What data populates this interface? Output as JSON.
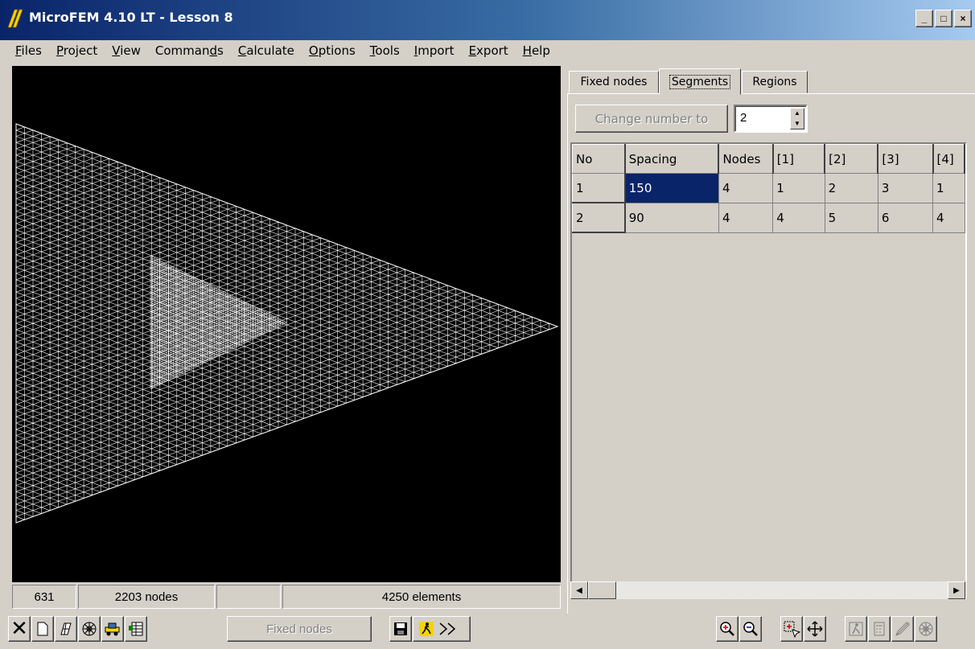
{
  "window": {
    "title": "MicroFEM 4.10 LT - Lesson 8",
    "minimize": "_",
    "maximize": "□",
    "close": "×"
  },
  "menu": [
    {
      "u": "F",
      "rest": "iles"
    },
    {
      "u": "P",
      "rest": "roject"
    },
    {
      "u": "V",
      "rest": "iew"
    },
    {
      "pre": "Comman",
      "u": "d",
      "rest": "s"
    },
    {
      "u": "C",
      "rest": "alculate"
    },
    {
      "u": "O",
      "rest": "ptions"
    },
    {
      "u": "T",
      "rest": "ools"
    },
    {
      "u": "I",
      "rest": "mport"
    },
    {
      "u": "E",
      "rest": "xport"
    },
    {
      "u": "H",
      "rest": "elp"
    }
  ],
  "status": {
    "coord": "631",
    "nodes": "2203 nodes",
    "empty": "",
    "elements": "4250 elements"
  },
  "tabs": {
    "fixed_nodes": "Fixed nodes",
    "segments": "Segments",
    "regions": "Regions"
  },
  "segments_panel": {
    "change_label": "Change number to",
    "change_value": "2"
  },
  "grid": {
    "headers": [
      "No",
      "Spacing",
      "Nodes",
      "[1]",
      "[2]",
      "[3]",
      "[4]"
    ],
    "rows": [
      [
        "1",
        "150",
        "4",
        "1",
        "2",
        "3",
        "1"
      ],
      [
        "2",
        "90",
        "4",
        "4",
        "5",
        "6",
        "4"
      ]
    ]
  },
  "toolbar": {
    "fixed_nodes": "Fixed nodes"
  },
  "colors": {
    "mesh": "#ffffff",
    "background": "#000000",
    "selection": "#0a246a"
  }
}
